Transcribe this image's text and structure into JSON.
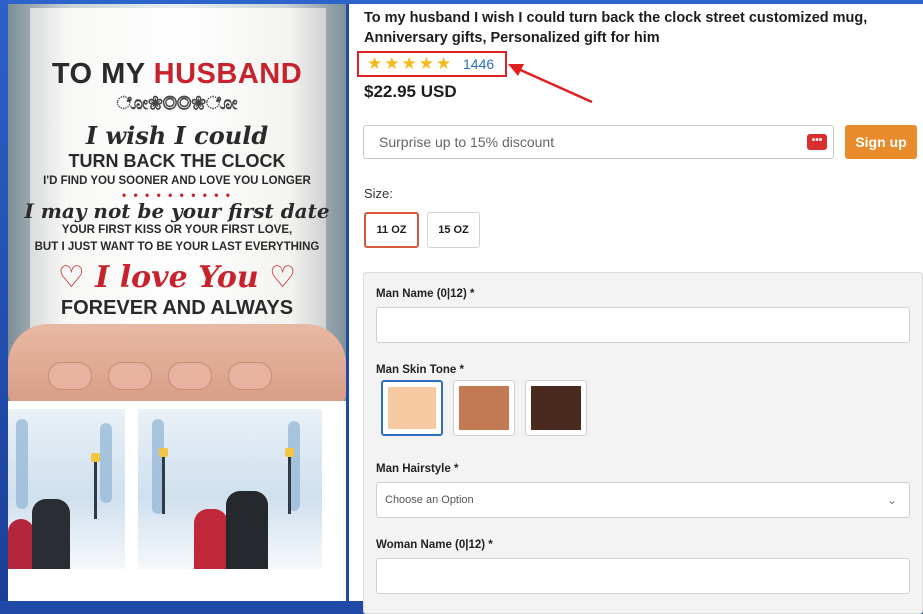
{
  "product": {
    "title": "To my husband I wish I could turn back the clock street customized mug, Anniversary gifts, Personalized gift for him",
    "rating_stars": "★★★★★",
    "rating_count": "1446",
    "price": "$22.95 USD"
  },
  "mug_print": {
    "line1a": "TO MY ",
    "line1b": "HUSBAND",
    "ornament": "ೋ❀◎◎❀ೋ",
    "line2": "I wish I could",
    "line3": "TURN BACK THE CLOCK",
    "line4": "I'D FIND YOU SOONER AND LOVE YOU LONGER",
    "dots": "• • • • • • • • • •",
    "line5": "I may not be your first date",
    "line6": "YOUR FIRST KISS OR YOUR FIRST LOVE,",
    "line7": "BUT I JUST WANT TO BE YOUR LAST EVERYTHING",
    "line8": "♡ I love You ♡",
    "line9": "FOREVER AND ALWAYS"
  },
  "discount": {
    "placeholder": "Surprise up to 15% discount",
    "icon": "chat-bubble-icon",
    "signup_label": "Sign up"
  },
  "size": {
    "label": "Size:",
    "options": [
      "11 OZ",
      "15 OZ"
    ],
    "selected": "11 OZ"
  },
  "form": {
    "man_name_label": "Man Name (0|12) *",
    "skin_tone_label": "Man Skin Tone *",
    "skin_tones": [
      "#f7c9a0",
      "#c27a52",
      "#4a2a1e"
    ],
    "hairstyle_label": "Man Hairstyle *",
    "hairstyle_placeholder": "Choose an Option",
    "woman_name_label": "Woman Name (0|12) *"
  },
  "colors": {
    "accent": "#e98b2a",
    "highlight": "#e02020",
    "star": "#f3b91e",
    "link": "#2a6fb5"
  }
}
